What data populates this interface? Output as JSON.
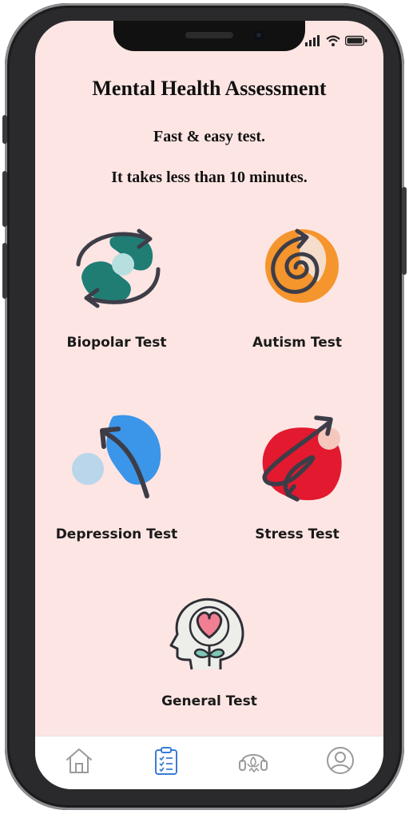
{
  "header": {
    "title": "Mental Health Assessment",
    "subtitle_line1": "Fast & easy test.",
    "subtitle_line2": "It takes less than 10 minutes."
  },
  "tests": [
    {
      "label": "Biopolar Test",
      "icon": "bipolar-icon"
    },
    {
      "label": "Autism Test",
      "icon": "autism-icon"
    },
    {
      "label": "Depression Test",
      "icon": "depression-icon"
    },
    {
      "label": "Stress Test",
      "icon": "stress-icon"
    },
    {
      "label": "General Test",
      "icon": "general-icon"
    }
  ],
  "tabbar": {
    "items": [
      "home-icon",
      "clipboard-icon",
      "meditation-icon",
      "profile-icon"
    ],
    "active": "clipboard-icon",
    "active_color": "#3a7bd5"
  },
  "colors": {
    "background": "#fde5e3",
    "teal": "#1f7d74",
    "orange": "#f5952d",
    "blue": "#3b95e8",
    "red": "#e3192f"
  }
}
